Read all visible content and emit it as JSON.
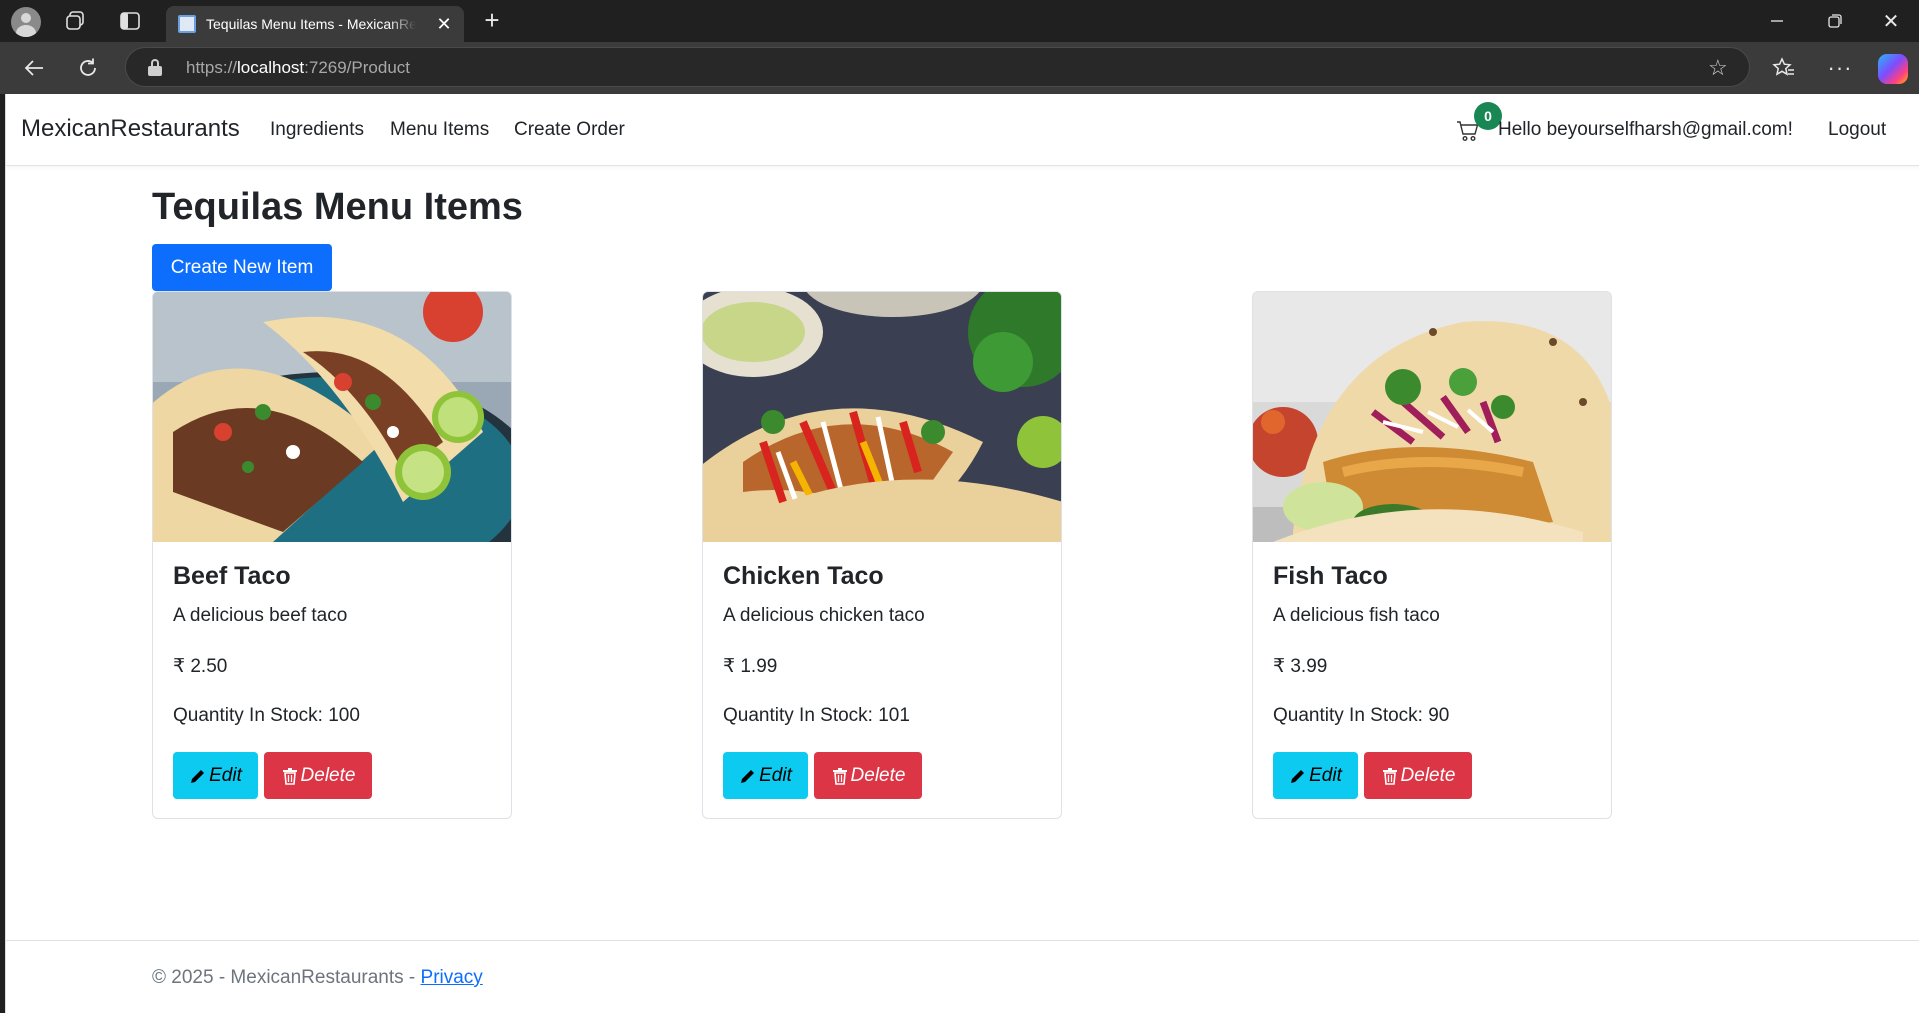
{
  "browser": {
    "tab_title": "Tequilas Menu Items - MexicanRestaurants",
    "url_scheme": "https://",
    "url_host": "localhost",
    "url_path": ":7269/Product"
  },
  "navbar": {
    "brand": "MexicanRestaurants",
    "links": [
      "Ingredients",
      "Menu Items",
      "Create Order"
    ],
    "cart_count": "0",
    "greeting": "Hello beyourselfharsh@gmail.com!",
    "logout": "Logout"
  },
  "main": {
    "title": "Tequilas Menu Items",
    "create_button": "Create New Item",
    "edit_label": "Edit",
    "delete_label": "Delete",
    "items": [
      {
        "name": "Beef Taco",
        "description": "A delicious beef taco",
        "price": "₹ 2.50",
        "stock": "Quantity In Stock: 100"
      },
      {
        "name": "Chicken Taco",
        "description": "A delicious chicken taco",
        "price": "₹ 1.99",
        "stock": "Quantity In Stock: 101"
      },
      {
        "name": "Fish Taco",
        "description": "A delicious fish taco",
        "price": "₹ 3.99",
        "stock": "Quantity In Stock: 90"
      }
    ]
  },
  "footer": {
    "text": "© 2025 - MexicanRestaurants - ",
    "privacy": "Privacy"
  },
  "colors": {
    "primary": "#0d6efd",
    "info": "#0dcaf0",
    "danger": "#dc3545",
    "success": "#198754"
  }
}
